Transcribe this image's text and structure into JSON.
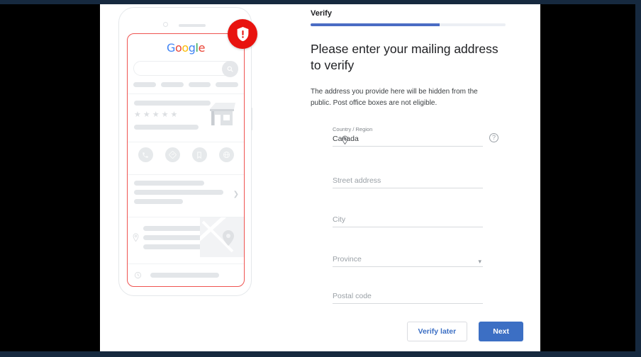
{
  "window": {
    "frame_color": "#16293f",
    "letterbox_color": "#000000",
    "canvas_color": "#ffffff"
  },
  "illustration": {
    "name": "google-business-profile-phone-mockup",
    "brand_logo": "Google",
    "brand_letters": [
      "G",
      "o",
      "o",
      "g",
      "l",
      "e"
    ],
    "badge": {
      "icon": "shield-alert-icon",
      "color": "#e8130f"
    },
    "search_icon": "search-icon",
    "rating_stars": 5,
    "rating_star_glyph": "★",
    "action_icons": [
      "phone-icon",
      "directions-icon",
      "save-icon",
      "website-icon"
    ],
    "detail_icons": [
      "location-pin-icon",
      "clock-icon",
      "phone-icon",
      "website-icon"
    ],
    "chevron_icon": "chevron-right-icon",
    "storefront_icon": "storefront-icon",
    "map_pin_icon": "map-pin-icon"
  },
  "form": {
    "tab_label": "Verify",
    "progress_percent": 66,
    "progress_color": "#4a6cc4",
    "headline": "Please enter your mailing address to verify",
    "subtext": "The address you provide here will be hidden from the public. Post office boxes are not eligible.",
    "fields": [
      {
        "name": "country-region",
        "label": "Country / Region",
        "value": "Canada",
        "leading_icon": "location-pin-icon",
        "trailing_icon": "help-circle-icon",
        "help_glyph": "?"
      },
      {
        "name": "street-address",
        "placeholder": "Street address"
      },
      {
        "name": "city",
        "placeholder": "City"
      },
      {
        "name": "province",
        "placeholder": "Province",
        "trailing_icon": "chevron-down-icon"
      },
      {
        "name": "postal-code",
        "placeholder": "Postal code"
      }
    ],
    "buttons": {
      "secondary_label": "Verify later",
      "primary_label": "Next",
      "primary_color": "#3c6fc4",
      "secondary_text_color": "#3c6fc4"
    }
  }
}
